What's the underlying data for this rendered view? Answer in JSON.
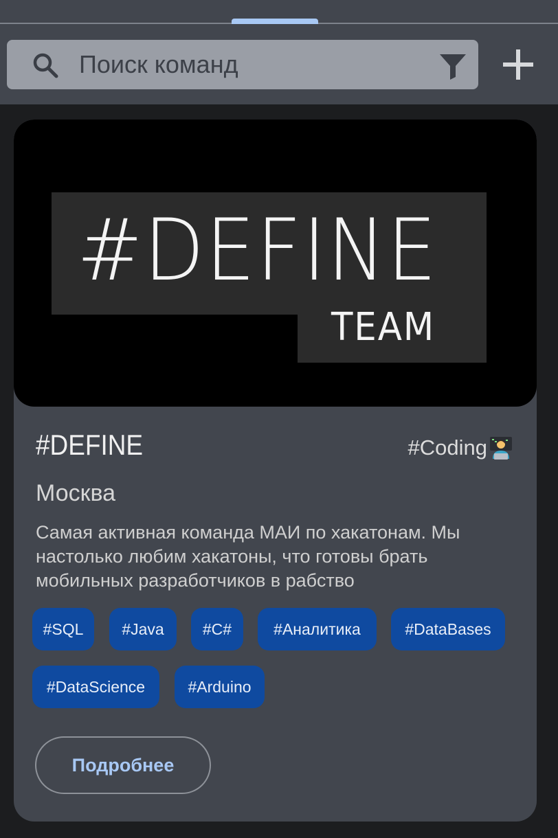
{
  "search": {
    "placeholder": "Поиск команд"
  },
  "card": {
    "banner": {
      "logo_main": "#DEFINE",
      "logo_sub": "TEAM"
    },
    "name": "#DEFINE",
    "category": "#Coding",
    "category_icon": "technologist-emoji",
    "city": "Москва",
    "description": "Самая активная команда МАИ по хакатонам. Мы настолько любим хакатоны, что готовы брать мобильных разработчиков в рабство",
    "tags": [
      "#SQL",
      "#Java",
      "#C#",
      "#Аналитика",
      "#DataBases",
      "#DataScience",
      "#Arduino"
    ],
    "more_label": "Подробнее"
  },
  "colors": {
    "topbar": "#42464e",
    "background": "#1c1d1f",
    "card": "#42464e",
    "tag": "#0f4aa0",
    "accent": "#a8c8f4"
  }
}
